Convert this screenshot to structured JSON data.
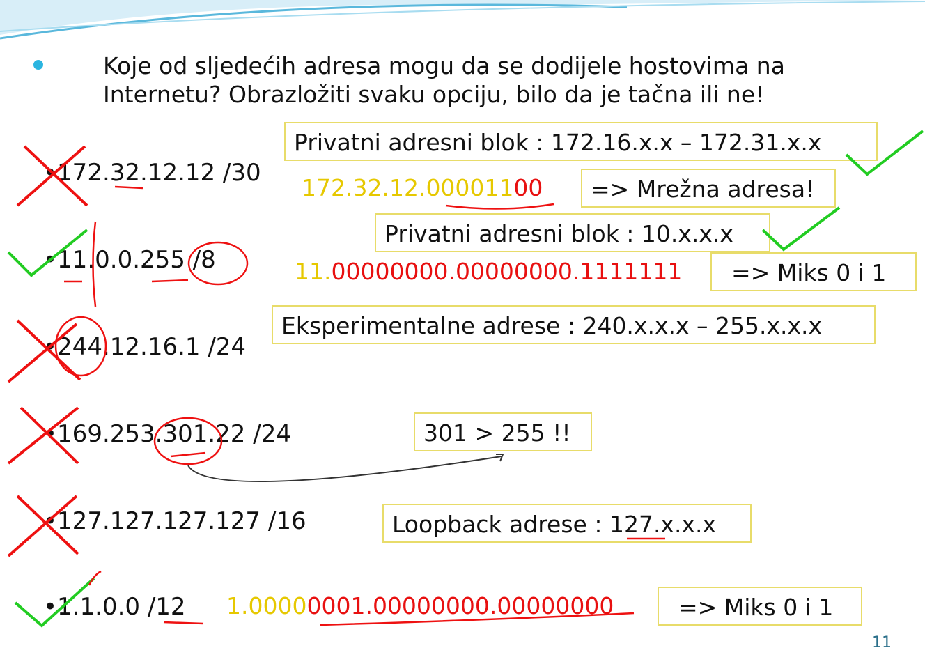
{
  "question": {
    "line1": "Koje od sljedećih adresa mogu da se dodijele hostovima na",
    "line2": "Internetu? Obrazložiti svaku opciju, bilo da je tačna ili ne!"
  },
  "items": [
    {
      "text": "•172.32.12.12 /30",
      "mark": "wrong"
    },
    {
      "text": "•11.0.0.255 /8",
      "mark": "correct"
    },
    {
      "text": "•244.12.16.1 /24",
      "mark": "wrong"
    },
    {
      "text": "•169.253.301.22 /24",
      "mark": "wrong"
    },
    {
      "text": "•127.127.127.127 /16",
      "mark": "wrong"
    },
    {
      "text": "•1.1.0.0 /12",
      "mark": "correct"
    }
  ],
  "boxes": {
    "b1": "Privatni adresni blok : 172.16.x.x – 172.31.x.x",
    "b2": "=> Mrežna adresa!",
    "b3": "Privatni adresni blok : 10.x.x.x",
    "b4": "=> Miks 0 i 1",
    "b5": "Eksperimentalne adrese : 240.x.x.x – 255.x.x.x",
    "b6": "301 > 255 !!",
    "b7": "Loopback adrese : 127.x.x.x",
    "b8": "=> Miks 0 i 1"
  },
  "binary": {
    "a_y": "172.32.12.000011",
    "a_r": "00",
    "b_y": "11.",
    "b_r": "00000000.00000000.1111111",
    "c_y": "1.0000",
    "c_r": "0001.00000000.00000000"
  },
  "page_number": "11",
  "colors": {
    "yellow": "#e6c800",
    "red": "#e81010",
    "green": "#22cc22",
    "box_border": "#e8dc6a"
  }
}
